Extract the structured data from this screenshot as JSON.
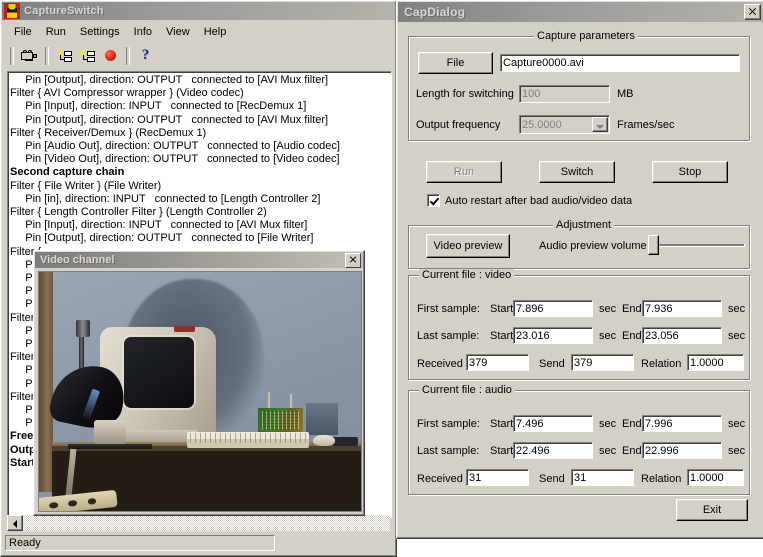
{
  "main_window": {
    "title": "CaptureSwitch",
    "sysicon": "app-icon",
    "menu": [
      "File",
      "Run",
      "Settings",
      "Info",
      "View",
      "Help"
    ],
    "toolbar": [
      {
        "name": "capture-device-icon",
        "kind": "camera"
      },
      {
        "name": "build-graph-icon",
        "kind": "graph1"
      },
      {
        "name": "show-graph-icon",
        "kind": "graph2"
      },
      {
        "name": "record-icon",
        "kind": "record"
      },
      {
        "name": "help-icon",
        "kind": "help"
      }
    ],
    "log_lines": [
      {
        "text": "     Pin [Output], direction: OUTPUT   connected to [AVI Mux filter]",
        "bold": false
      },
      {
        "text": "Filter { AVI Compressor wrapper } (Video codec)",
        "bold": false
      },
      {
        "text": "     Pin [Input], direction: INPUT   connected to [RecDemux 1]",
        "bold": false
      },
      {
        "text": "     Pin [Output], direction: OUTPUT   connected to [AVI Mux filter]",
        "bold": false
      },
      {
        "text": "Filter { Receiver/Demux } (RecDemux 1)",
        "bold": false
      },
      {
        "text": "     Pin [Audio Out], direction: OUTPUT   connected to [Audio codec]",
        "bold": false
      },
      {
        "text": "     Pin [Video Out], direction: OUTPUT   connected to [Video codec]",
        "bold": false
      },
      {
        "text": "",
        "bold": false
      },
      {
        "text": "Second capture chain",
        "bold": true
      },
      {
        "text": "Filter { File Writer } (File Writer)",
        "bold": false
      },
      {
        "text": "     Pin [in], direction: INPUT   connected to [Length Controller 2]",
        "bold": false
      },
      {
        "text": "Filter { Length Controller Filter } (Length Controller 2)",
        "bold": false
      },
      {
        "text": "     Pin [Input], direction: INPUT   connected to [AVI Mux filter]",
        "bold": false
      },
      {
        "text": "     Pin [Output], direction: OUTPUT   connected to [File Writer]",
        "bold": false
      },
      {
        "text": "Filter {",
        "bold": false
      },
      {
        "text": "     P",
        "bold": false
      },
      {
        "text": "     P",
        "bold": false
      },
      {
        "text": "     P",
        "bold": false
      },
      {
        "text": "     P",
        "bold": false
      },
      {
        "text": "Filter {",
        "bold": false
      },
      {
        "text": "     P",
        "bold": false
      },
      {
        "text": "     P",
        "bold": false
      },
      {
        "text": "Filter {",
        "bold": false
      },
      {
        "text": "     P",
        "bold": false
      },
      {
        "text": "     P",
        "bold": false
      },
      {
        "text": "Filter {",
        "bold": false
      },
      {
        "text": "     P",
        "bold": false
      },
      {
        "text": "     P",
        "bold": false
      },
      {
        "text": "",
        "bold": false
      },
      {
        "text": "Free",
        "bold": true
      },
      {
        "text": "Outp",
        "bold": true
      },
      {
        "text": "Start",
        "bold": true
      }
    ],
    "status_text": "Ready"
  },
  "video_window": {
    "title": "Video channel",
    "close_label": "x",
    "scene_description": "CRT monitor, keyboard and mouse on a desk with a desk lamp and a circuit board"
  },
  "dialog": {
    "title": "CapDialog",
    "close_label": "x",
    "capture_parameters": {
      "legend": "Capture parameters",
      "file_button": "File",
      "file_value": "Capture0000.avi",
      "length_label": "Length for switching",
      "length_value": "100",
      "length_unit": "MB",
      "frequency_label": "Output frequency",
      "frequency_value": "25.0000",
      "frequency_unit": "Frames/sec"
    },
    "actions": {
      "run": "Run",
      "switch": "Switch",
      "stop": "Stop"
    },
    "auto_restart": {
      "label": "Auto restart after bad audio/video data",
      "checked": true
    },
    "adjustment": {
      "legend": "Adjustment",
      "video_preview_button": "Video preview",
      "volume_label": "Audio preview volume",
      "volume_position": 0
    },
    "current_video": {
      "legend": "Current file : video",
      "first_sample_label": "First sample:",
      "last_sample_label": "Last sample:",
      "start_label": "Start",
      "end_label": "End",
      "sec_unit": "sec",
      "first_start": "7.896",
      "first_end": "7.936",
      "last_start": "23.016",
      "last_end": "23.056",
      "received_label": "Received",
      "received": "379",
      "send_label": "Send",
      "send": "379",
      "relation_label": "Relation",
      "relation": "1.0000"
    },
    "current_audio": {
      "legend": "Current file : audio",
      "first_sample_label": "First sample:",
      "last_sample_label": "Last sample:",
      "start_label": "Start",
      "end_label": "End",
      "sec_unit": "sec",
      "first_start": "7.496",
      "first_end": "7.996",
      "last_start": "22.496",
      "last_end": "22.996",
      "received_label": "Received",
      "received": "31",
      "send_label": "Send",
      "send": "31",
      "relation_label": "Relation",
      "relation": "1.0000"
    },
    "exit_button": "Exit"
  },
  "colors": {
    "face": "#d4d0c8",
    "shadow": "#808080",
    "titlebar_inactive": "#9a9a9a",
    "record_red": "#e02010",
    "disabled_text": "#808080"
  }
}
